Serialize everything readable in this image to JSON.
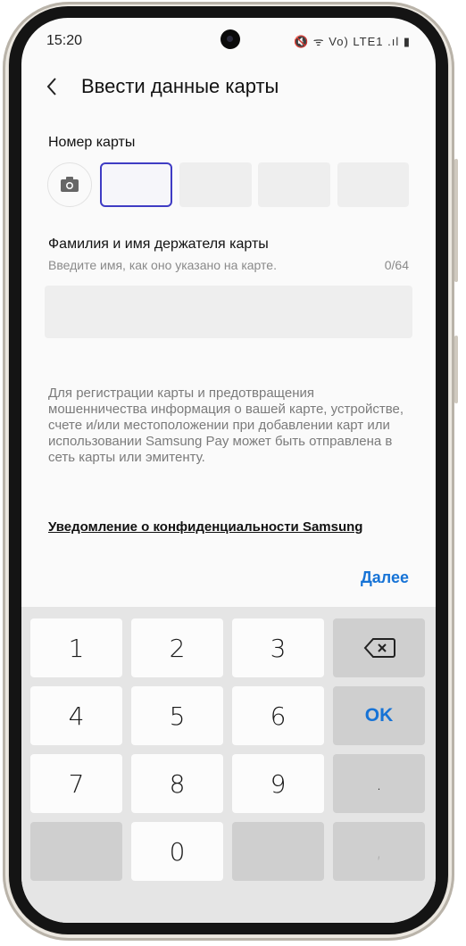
{
  "status_bar": {
    "time": "15:20",
    "icons": "🔇 ᯤ Vo) LTE1 .ıl ▮"
  },
  "header": {
    "title": "Ввести данные карты"
  },
  "card_number": {
    "label": "Номер карты"
  },
  "card_holder": {
    "label": "Фамилия и имя держателя карты",
    "hint": "Введите имя, как оно указано на карте.",
    "counter": "0/64",
    "value": ""
  },
  "disclaimer": "Для регистрации карты и предотвращения мошенничества информация о вашей карте, устройстве, счете и/или местоположении при добавлении карт или использовании Samsung Pay может быть отправлена в сеть карты или эмитенту.",
  "privacy_link": "Уведомление о конфиденциальности Samsung",
  "next_button": "Далее",
  "keyboard": {
    "k1": "1",
    "k2": "2",
    "k3": "3",
    "k4": "4",
    "k5": "5",
    "k6": "6",
    "k7": "7",
    "k8": "8",
    "k9": "9",
    "k0": "0",
    "ok": "OK",
    "dot": ".",
    "comma": ","
  },
  "colors": {
    "accent": "#1673d6",
    "active_field_border": "#3f3cc4"
  }
}
